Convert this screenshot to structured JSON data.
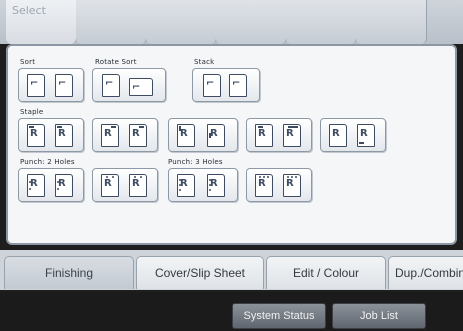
{
  "top_tabs": [
    "Select",
    "",
    "",
    "",
    "",
    ""
  ],
  "sections": {
    "sort_label": "Sort",
    "rotate_sort_label": "Rotate Sort",
    "stack_label": "Stack",
    "staple_label": "Staple",
    "punch2_label": "Punch: 2 Holes",
    "punch3_label": "Punch: 3 Holes"
  },
  "paper_glyph": "R",
  "bottom_tabs": {
    "finishing": "Finishing",
    "cover": "Cover/Slip Sheet",
    "edit": "Edit / Colour",
    "dup": "Dup./Combine"
  },
  "footer": {
    "system_status": "System Status",
    "job_list": "Job List"
  },
  "colors": {
    "panel_border": "#8c97a3",
    "icon_ink": "#3d4c62",
    "footer_bg": "#1b1b1b"
  }
}
